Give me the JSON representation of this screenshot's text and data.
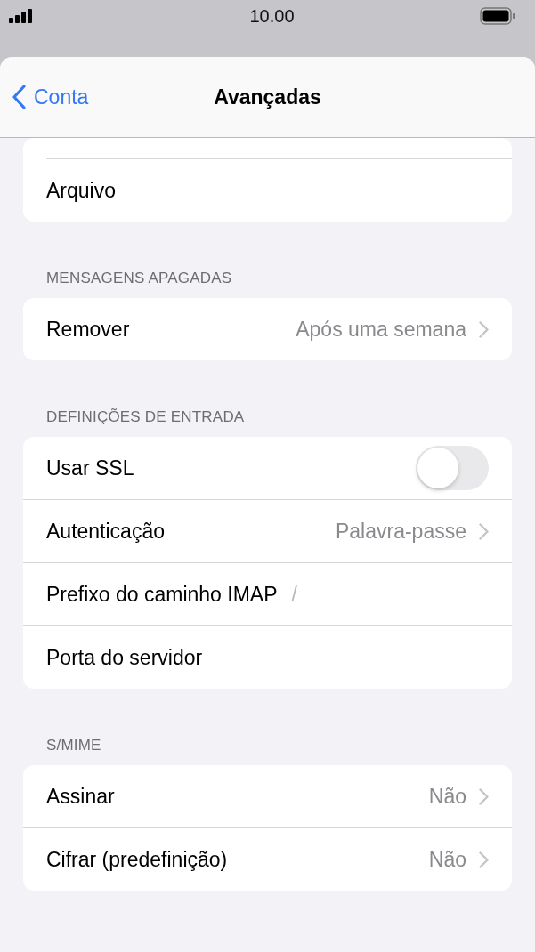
{
  "status_bar": {
    "time": "10.00"
  },
  "nav": {
    "back": "Conta",
    "title": "Avançadas"
  },
  "sections": [
    {
      "rows": [
        {
          "kind": "plain",
          "label": "Arquivo"
        }
      ]
    },
    {
      "header": "MENSAGENS APAGADAS",
      "rows": [
        {
          "kind": "value",
          "label": "Remover",
          "value": "Após uma semana"
        }
      ]
    },
    {
      "header": "DEFINIÇÕES DE ENTRADA",
      "rows": [
        {
          "kind": "toggle",
          "label": "Usar SSL",
          "on": false
        },
        {
          "kind": "value",
          "label": "Autenticação",
          "value": "Palavra-passe"
        },
        {
          "kind": "field",
          "label": "Prefixo do caminho IMAP",
          "value": "/"
        },
        {
          "kind": "plain",
          "label": "Porta do servidor"
        }
      ]
    },
    {
      "header": "S/MIME",
      "rows": [
        {
          "kind": "value",
          "label": "Assinar",
          "value": "Não"
        },
        {
          "kind": "value",
          "label": "Cifrar (predefinição)",
          "value": "Não"
        }
      ]
    }
  ]
}
